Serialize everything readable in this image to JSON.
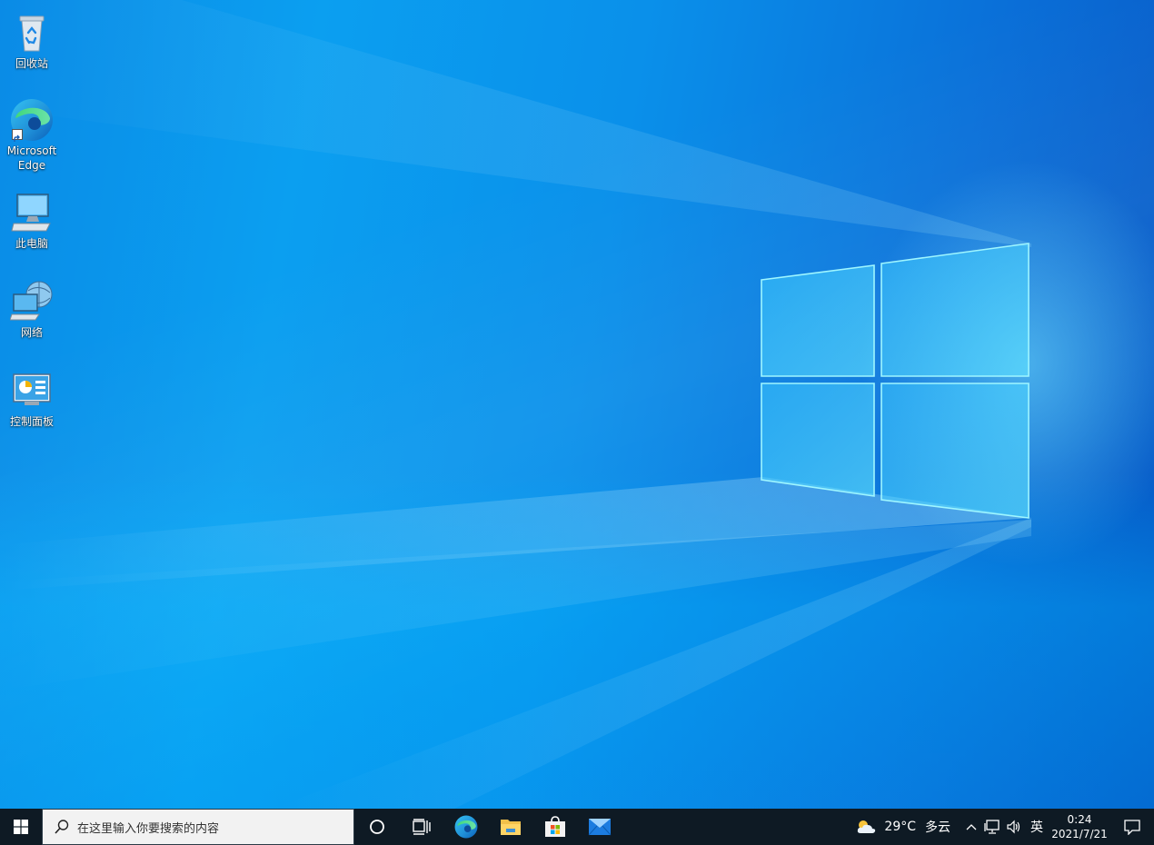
{
  "desktop": {
    "icons": [
      {
        "name": "recycle-bin",
        "label": "回收站"
      },
      {
        "name": "microsoft-edge",
        "label": "Microsoft Edge"
      },
      {
        "name": "this-pc",
        "label": "此电脑"
      },
      {
        "name": "network",
        "label": "网络"
      },
      {
        "name": "control-panel",
        "label": "控制面板"
      }
    ]
  },
  "taskbar": {
    "search_placeholder": "在这里输入你要搜索的内容",
    "pinned_apps": [
      "cortana-icon",
      "task-view-icon",
      "edge-icon",
      "file-explorer-icon",
      "store-icon",
      "mail-icon"
    ],
    "tray": {
      "weather_temp": "29°C",
      "weather_desc": "多云",
      "language": "英",
      "time": "0:24",
      "date": "2021/7/21"
    }
  },
  "colors": {
    "taskbar": "#0e1a24",
    "desktop_accent": "#0a78d8"
  }
}
